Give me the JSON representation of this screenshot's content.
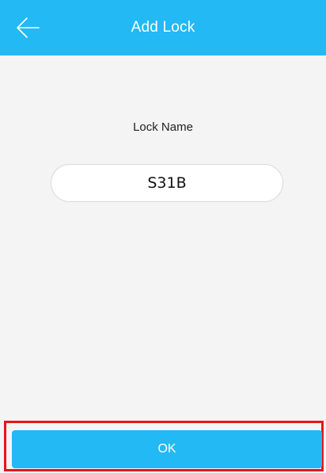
{
  "header": {
    "title": "Add Lock",
    "back_icon": "back-arrow-icon"
  },
  "form": {
    "lock_name_label": "Lock Name",
    "lock_name_value": "S31B"
  },
  "footer": {
    "ok_label": "OK"
  },
  "colors": {
    "accent": "#22b9f4",
    "background": "#f4f4f4",
    "highlight": "#e8141c"
  }
}
